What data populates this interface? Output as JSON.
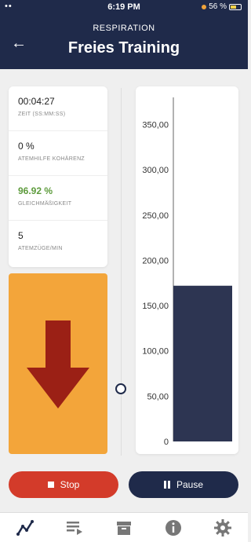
{
  "status_bar": {
    "time": "6:19 PM",
    "battery": "56 %",
    "carrier": "••"
  },
  "header": {
    "subtitle": "RESPIRATION",
    "title": "Freies Training"
  },
  "stats": [
    {
      "value": "00:04:27",
      "label": "ZEIT (SS:MM:SS)",
      "accent": "normal"
    },
    {
      "value": "0 %",
      "label": "ATEMHILFE KOHÄRENZ",
      "accent": "normal"
    },
    {
      "value": "96.92 %",
      "label": "GLEICHMÄßIGKEIT",
      "accent": "green"
    },
    {
      "value": "5",
      "label": "ATEMZÜGE/MIN",
      "accent": "normal"
    }
  ],
  "arrow": {
    "direction": "down",
    "color": "#9b2015",
    "background": "#f3a53a"
  },
  "chart_data": {
    "type": "bar",
    "categories": [
      ""
    ],
    "values": [
      172
    ],
    "ylim": [
      0,
      380
    ],
    "yticks": [
      "0",
      "50,00",
      "100,00",
      "150,00",
      "200,00",
      "250,00",
      "300,00",
      "350,00"
    ],
    "ytick_values": [
      0,
      50,
      100,
      150,
      200,
      250,
      300,
      350
    ],
    "bar_color": "#2d3552",
    "grid": false
  },
  "buttons": {
    "stop": "Stop",
    "pause": "Pause"
  },
  "tabs": [
    "graph-icon",
    "playlist-icon",
    "archive-icon",
    "info-icon",
    "settings-icon"
  ],
  "colors": {
    "header": "#1f2a4a",
    "stop": "#d33b2a",
    "pause": "#1f2a4a",
    "green": "#5d9b3c"
  }
}
